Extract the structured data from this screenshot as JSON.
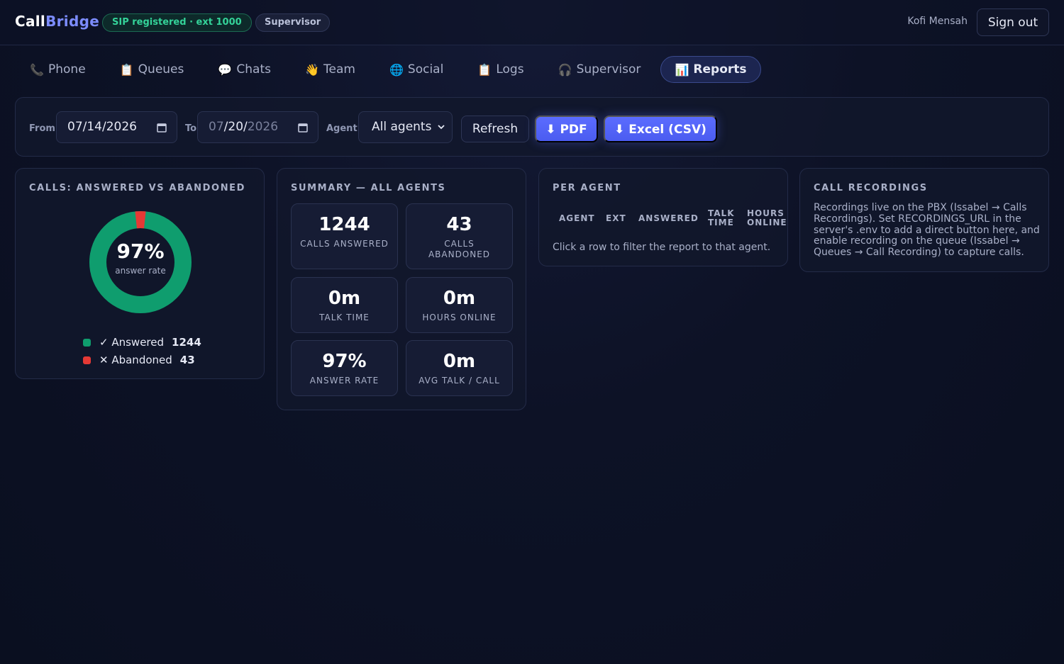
{
  "header": {
    "brand_part1": "Call",
    "brand_part2": "Bridge",
    "sip_status": "SIP registered · ext 1000",
    "role": "Supervisor",
    "user_name": "Kofi Mensah",
    "signout_label": "Sign out"
  },
  "tabs": [
    {
      "icon": "📞",
      "label": "Phone"
    },
    {
      "icon": "📋",
      "label": "Queues"
    },
    {
      "icon": "💬",
      "label": "Chats"
    },
    {
      "icon": "👋",
      "label": "Team"
    },
    {
      "icon": "🌐",
      "label": "Social"
    },
    {
      "icon": "📋",
      "label": "Logs"
    },
    {
      "icon": "🎧",
      "label": "Supervisor"
    },
    {
      "icon": "📊",
      "label": "Reports"
    }
  ],
  "filters": {
    "from_label": "From",
    "from_value": "07/14/2026",
    "to_label": "To",
    "to_value_month": "07",
    "to_value_sep1": "/",
    "to_value_day": "20",
    "to_value_sep2": "/",
    "to_value_year": "2026",
    "agent_label": "Agent",
    "agent_selected": "All agents",
    "refresh_label": "Refresh",
    "pdf_label": "⬇ PDF",
    "csv_label": "⬇ Excel (CSV)"
  },
  "calls_card": {
    "title": "CALLS: ANSWERED VS ABANDONED",
    "percent": "97%",
    "percent_sub": "answer rate",
    "answered_label": "✓ Answered",
    "answered_count": "1244",
    "abandoned_label": "✕ Abandoned",
    "abandoned_count": "43",
    "answered_color": "#0f9d6e",
    "abandoned_color": "#e53935"
  },
  "summary_card": {
    "title": "SUMMARY — ALL AGENTS",
    "stats": [
      {
        "value": "1244",
        "label": "CALLS ANSWERED"
      },
      {
        "value": "43",
        "label": "CALLS ABANDONED"
      },
      {
        "value": "0m",
        "label": "TALK TIME"
      },
      {
        "value": "0m",
        "label": "HOURS ONLINE"
      },
      {
        "value": "97%",
        "label": "ANSWER RATE"
      },
      {
        "value": "0m",
        "label": "AVG TALK / CALL"
      }
    ]
  },
  "per_agent_card": {
    "title": "PER AGENT",
    "columns": [
      "AGENT",
      "EXT",
      "ANSWERED",
      "TALK TIME",
      "HOURS ONLINE"
    ],
    "hint": "Click a row to filter the report to that agent."
  },
  "recordings_card": {
    "title": "CALL RECORDINGS",
    "text": "Recordings live on the PBX (Issabel → Calls Recordings). Set RECORDINGS_URL in the server's .env to add a direct button here, and enable recording on the queue (Issabel → Queues → Call Recording) to capture calls."
  }
}
